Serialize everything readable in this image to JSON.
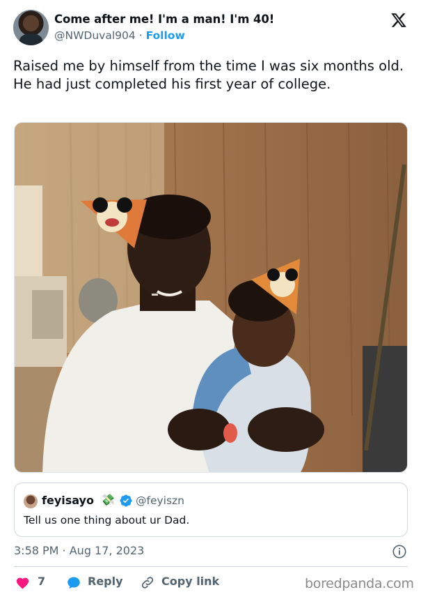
{
  "header": {
    "display_name": "Come after me! I'm a man! I'm 40!",
    "handle": "@NWDuval904",
    "separator": "·",
    "follow_label": "Follow",
    "avatar_icon": "user-avatar",
    "brand_icon": "x-logo-icon"
  },
  "tweet": {
    "text": "Raised me by himself from the time I was six months old. He had just completed his first year of college."
  },
  "photo": {
    "subject": "vintage-photo-father-and-baby-birthday-hats"
  },
  "quote": {
    "display_name": "feyisayo",
    "emoji": "💸",
    "verified_icon": "verified-badge-icon",
    "handle": "@feyiszn",
    "text": "Tell us one thing about ur Dad."
  },
  "meta": {
    "timestamp": "3:58 PM · Aug 17, 2023",
    "info_icon": "info-icon"
  },
  "actions": {
    "like_count": "7",
    "reply_label": "Reply",
    "copy_link_label": "Copy link"
  },
  "watermark": "boredpanda.com",
  "colors": {
    "accent": "#1d9bf0",
    "like": "#f91880",
    "text_primary": "#0f1419",
    "text_secondary": "#536471",
    "border": "#cfd9de"
  }
}
